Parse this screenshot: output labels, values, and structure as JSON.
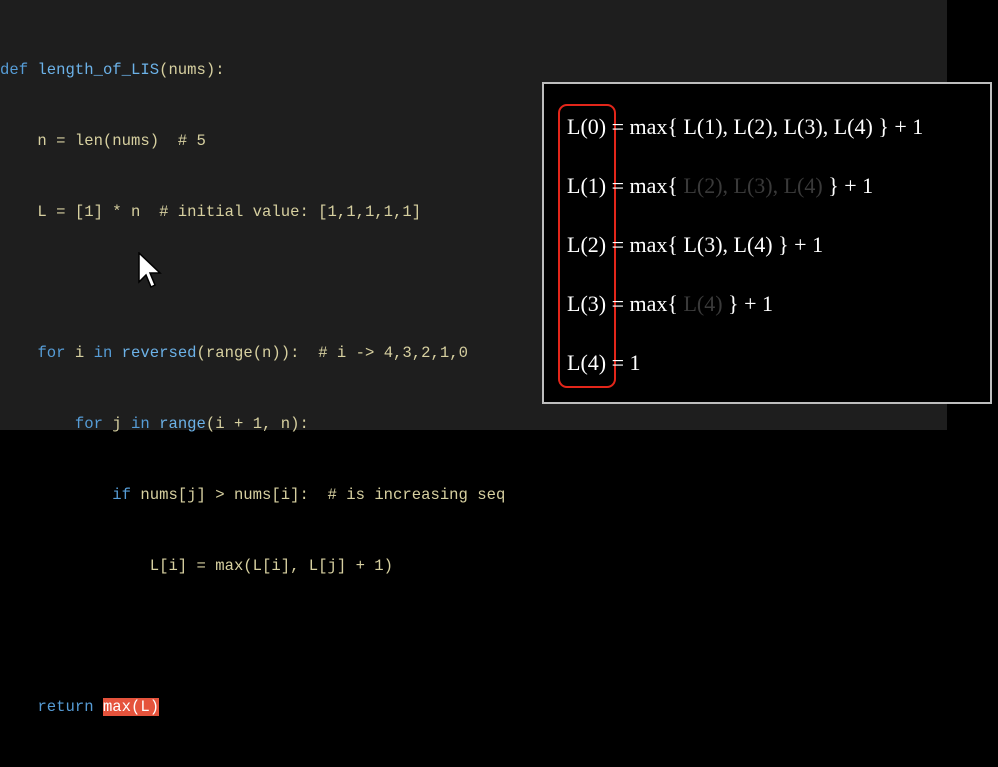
{
  "code": {
    "l1": {
      "kw": "def ",
      "fn": "length_of_LIS",
      "rest": "(nums):"
    },
    "l2": "    n = len(nums)  # 5",
    "l3": "    L = [1] * n  # initial value: [1,1,1,1,1]",
    "l5": {
      "indent": "    ",
      "kw": "for",
      "a": " i ",
      "kw2": "in",
      "b": " ",
      "fn": "reversed",
      "rest": "(range(n)):  # i -> 4,3,2,1,0"
    },
    "l6": {
      "indent": "        ",
      "kw": "for",
      "a": " j ",
      "kw2": "in",
      "b": " ",
      "fn": "range",
      "rest": "(i + 1, n):"
    },
    "l7": {
      "indent": "            ",
      "kw": "if",
      "rest": " nums[j] > nums[i]:  # is increasing seq"
    },
    "l8": "                L[i] = max(L[i], L[j] + 1)",
    "l10": {
      "indent": "    ",
      "kw": "return",
      "sp": " ",
      "hl": "max(L)"
    }
  },
  "panel": {
    "rows": [
      {
        "lhs": "L(0)",
        "mid": " = max{ ",
        "bright": "L(1), L(2), L(3), L(4)",
        "dim": "",
        "end": " } + 1"
      },
      {
        "lhs": "L(1)",
        "mid": " = max{ ",
        "bright": "",
        "dim": "L(2), L(3), L(4)",
        "end": " } + 1"
      },
      {
        "lhs": "L(2)",
        "mid": " = max{ ",
        "bright": "L(3), L(4)",
        "dim": "",
        "end": " } + 1"
      },
      {
        "lhs": "L(3)",
        "mid": " = max{ ",
        "bright": "",
        "dim": "L(4)",
        "end": " } + 1"
      },
      {
        "lhs": "L(4)",
        "mid": " = 1",
        "bright": "",
        "dim": "",
        "end": ""
      }
    ]
  },
  "colors": {
    "highlight": "#e5533c",
    "box": "#e3261a",
    "keyword": "#569cd6"
  }
}
